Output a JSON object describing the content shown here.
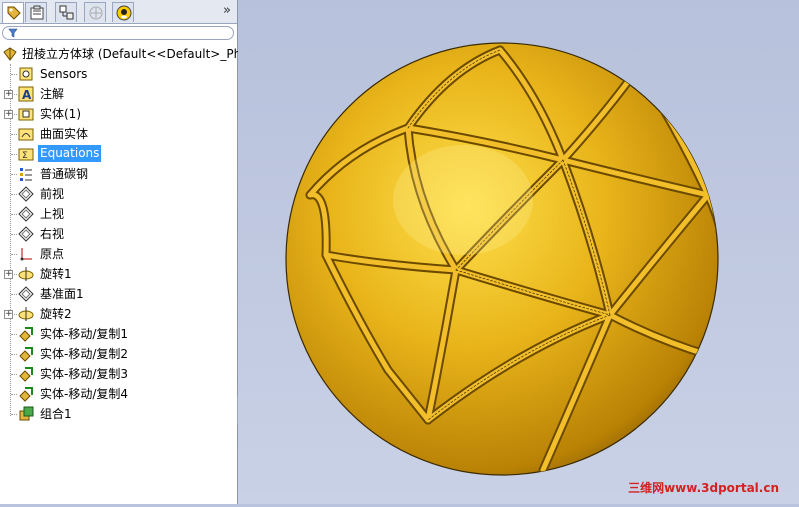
{
  "feature_manager": {
    "tabs": [
      {
        "icon": "feature-tree-icon"
      },
      {
        "icon": "property-manager-icon"
      },
      {
        "icon": "configuration-manager-icon"
      },
      {
        "icon": "dimxpert-icon"
      },
      {
        "icon": "appearance-icon"
      }
    ],
    "expand_glyph": "»",
    "root_label": "扭棱立方体球  (Default<<Default>_Ph",
    "items": [
      {
        "label": "Sensors",
        "icon": "sensors-icon",
        "expandable": false
      },
      {
        "label": "注解",
        "icon": "annotations-icon",
        "expandable": true
      },
      {
        "label": "实体(1)",
        "icon": "solid-bodies-icon",
        "expandable": true
      },
      {
        "label": "曲面实体",
        "icon": "surface-bodies-icon",
        "expandable": false
      },
      {
        "label": "Equations",
        "icon": "equations-icon",
        "expandable": false,
        "selected": true
      },
      {
        "label": "普通碳钢",
        "icon": "material-icon",
        "expandable": false
      },
      {
        "label": "前视",
        "icon": "plane-icon",
        "expandable": false
      },
      {
        "label": "上视",
        "icon": "plane-icon",
        "expandable": false
      },
      {
        "label": "右视",
        "icon": "plane-icon",
        "expandable": false
      },
      {
        "label": "原点",
        "icon": "origin-icon",
        "expandable": false
      },
      {
        "label": "旋转1",
        "icon": "revolve-icon",
        "expandable": true
      },
      {
        "label": "基准面1",
        "icon": "plane-icon",
        "expandable": false
      },
      {
        "label": "旋转2",
        "icon": "revolve-icon",
        "expandable": true
      },
      {
        "label": "实体-移动/复制1",
        "icon": "move-copy-icon",
        "expandable": false
      },
      {
        "label": "实体-移动/复制2",
        "icon": "move-copy-icon",
        "expandable": false
      },
      {
        "label": "实体-移动/复制3",
        "icon": "move-copy-icon",
        "expandable": false
      },
      {
        "label": "实体-移动/复制4",
        "icon": "move-copy-icon",
        "expandable": false
      },
      {
        "label": "组合1",
        "icon": "combine-icon",
        "expandable": false
      }
    ]
  },
  "watermark": {
    "cn": "三维网",
    "url": "www.3dportal.cn"
  },
  "colors": {
    "selection": "#3399ff",
    "model_gold": "#e0a812",
    "background": "#b9c3dd"
  }
}
